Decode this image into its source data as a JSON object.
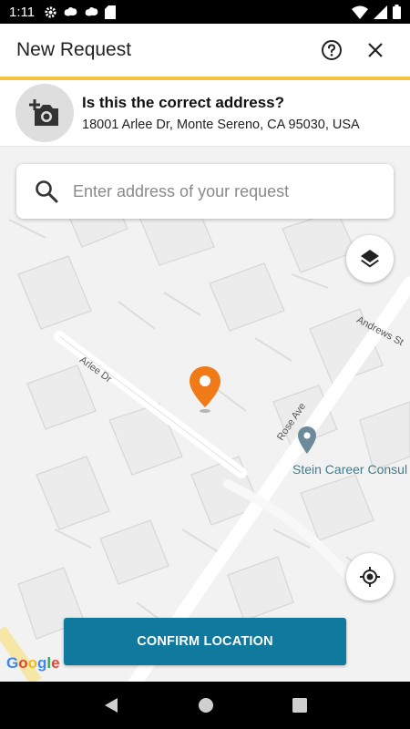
{
  "status_bar": {
    "time": "1:11",
    "left_icons": [
      "gear-icon",
      "cloud-icon",
      "cloud-icon",
      "sd-card-icon"
    ],
    "right_icons": [
      "wifi-icon",
      "cellular-icon",
      "battery-icon"
    ]
  },
  "header": {
    "title": "New Request",
    "help_icon": "help-circle-icon",
    "close_icon": "close-icon",
    "accent_color": "#f5c242"
  },
  "address_card": {
    "question": "Is this the correct address?",
    "address": "18001 Arlee Dr, Monte Sereno, CA 95030, USA",
    "photo_icon": "add-photo-icon"
  },
  "map": {
    "search": {
      "placeholder": "Enter address of your request",
      "value": ""
    },
    "streets": {
      "arlee": "Arlee Dr",
      "rose": "Rose Ave",
      "andrews": "Andrews St"
    },
    "poi_label": "Stein Career Consul",
    "confirm_label": "CONFIRM LOCATION",
    "confirm_color": "#0f7a9e",
    "pin_color": "#f07a18",
    "attribution": [
      "G",
      "o",
      "o",
      "g",
      "l",
      "e"
    ]
  },
  "nav_bar": {
    "icons": [
      "back-icon",
      "home-icon",
      "recents-icon"
    ]
  }
}
